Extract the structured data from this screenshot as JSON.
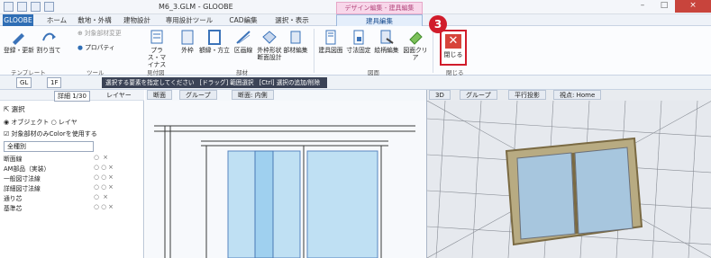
{
  "window": {
    "title": "M6_3.GLM - GLOOBE",
    "context_tab_title": "デザイン編集 - 建具編集",
    "buttons": {
      "minimize": "–",
      "maximize": "□",
      "close": "×"
    }
  },
  "tabs": [
    "GLOOBE",
    "ホーム",
    "敷地・外構",
    "建物設計",
    "専用設計ツール",
    "CAD編集",
    "選択・表示",
    "建具編集"
  ],
  "ribbon": {
    "buttons": [
      {
        "label": "登録・更新",
        "icon": "register-icon"
      },
      {
        "label": "割り当て",
        "icon": "assign-icon"
      },
      {
        "label": "対象部材変更",
        "icon": "change-target-icon"
      },
      {
        "label": "プロパティ",
        "icon": "property-icon"
      },
      {
        "label": "プラス・マイナス",
        "icon": "plus-minus-icon"
      },
      {
        "label": "外枠",
        "icon": "outer-frame-icon"
      },
      {
        "label": "額縁・方立",
        "icon": "trim-icon"
      },
      {
        "label": "区画線",
        "icon": "section-line-icon"
      },
      {
        "label": "外枠形状 断面設計",
        "icon": "frame-shape-icon"
      },
      {
        "label": "部材編集",
        "icon": "member-edit-icon"
      },
      {
        "label": "建具図面",
        "icon": "fitting-drawing-icon"
      },
      {
        "label": "寸法固定",
        "icon": "dimension-fix-icon"
      },
      {
        "label": "絵柄編集",
        "icon": "pattern-edit-icon"
      },
      {
        "label": "図面クリア",
        "icon": "drawing-clear-icon"
      }
    ],
    "groups": [
      "テンプレート",
      "ツール",
      "見付図",
      "部材",
      "図面",
      "閉じる"
    ],
    "close_label": "閉じる",
    "step_badge": "3"
  },
  "toolbar2": {
    "floor": "GL",
    "floor2": "1F",
    "hint_parts": [
      "選択する要素を指定してください",
      "[ドラッグ] 範囲選択",
      "[Ctrl] 選択の追加/削除"
    ]
  },
  "leftpanel": {
    "scale": "詳細 1/30",
    "layer_btn": "レイヤー",
    "select_title": "選択",
    "radio1": "オブジェクト",
    "radio2": "レイヤ",
    "checkbox": "対象部材のみColorを使用する",
    "category": "全種別",
    "layers": [
      "断面線",
      "AM部品（実装）",
      "一般図寸法線",
      "詳細図寸法線",
      "通り芯",
      "基準芯"
    ]
  },
  "view2d": {
    "tabs": [
      "断面",
      "グループ",
      "断面: 内側"
    ]
  },
  "view3d": {
    "tabs": [
      "3D",
      "グループ",
      "平行投影",
      "視点: Home"
    ]
  },
  "colors": {
    "accent": "#2f6eb5",
    "close_red": "#d11c2b"
  }
}
